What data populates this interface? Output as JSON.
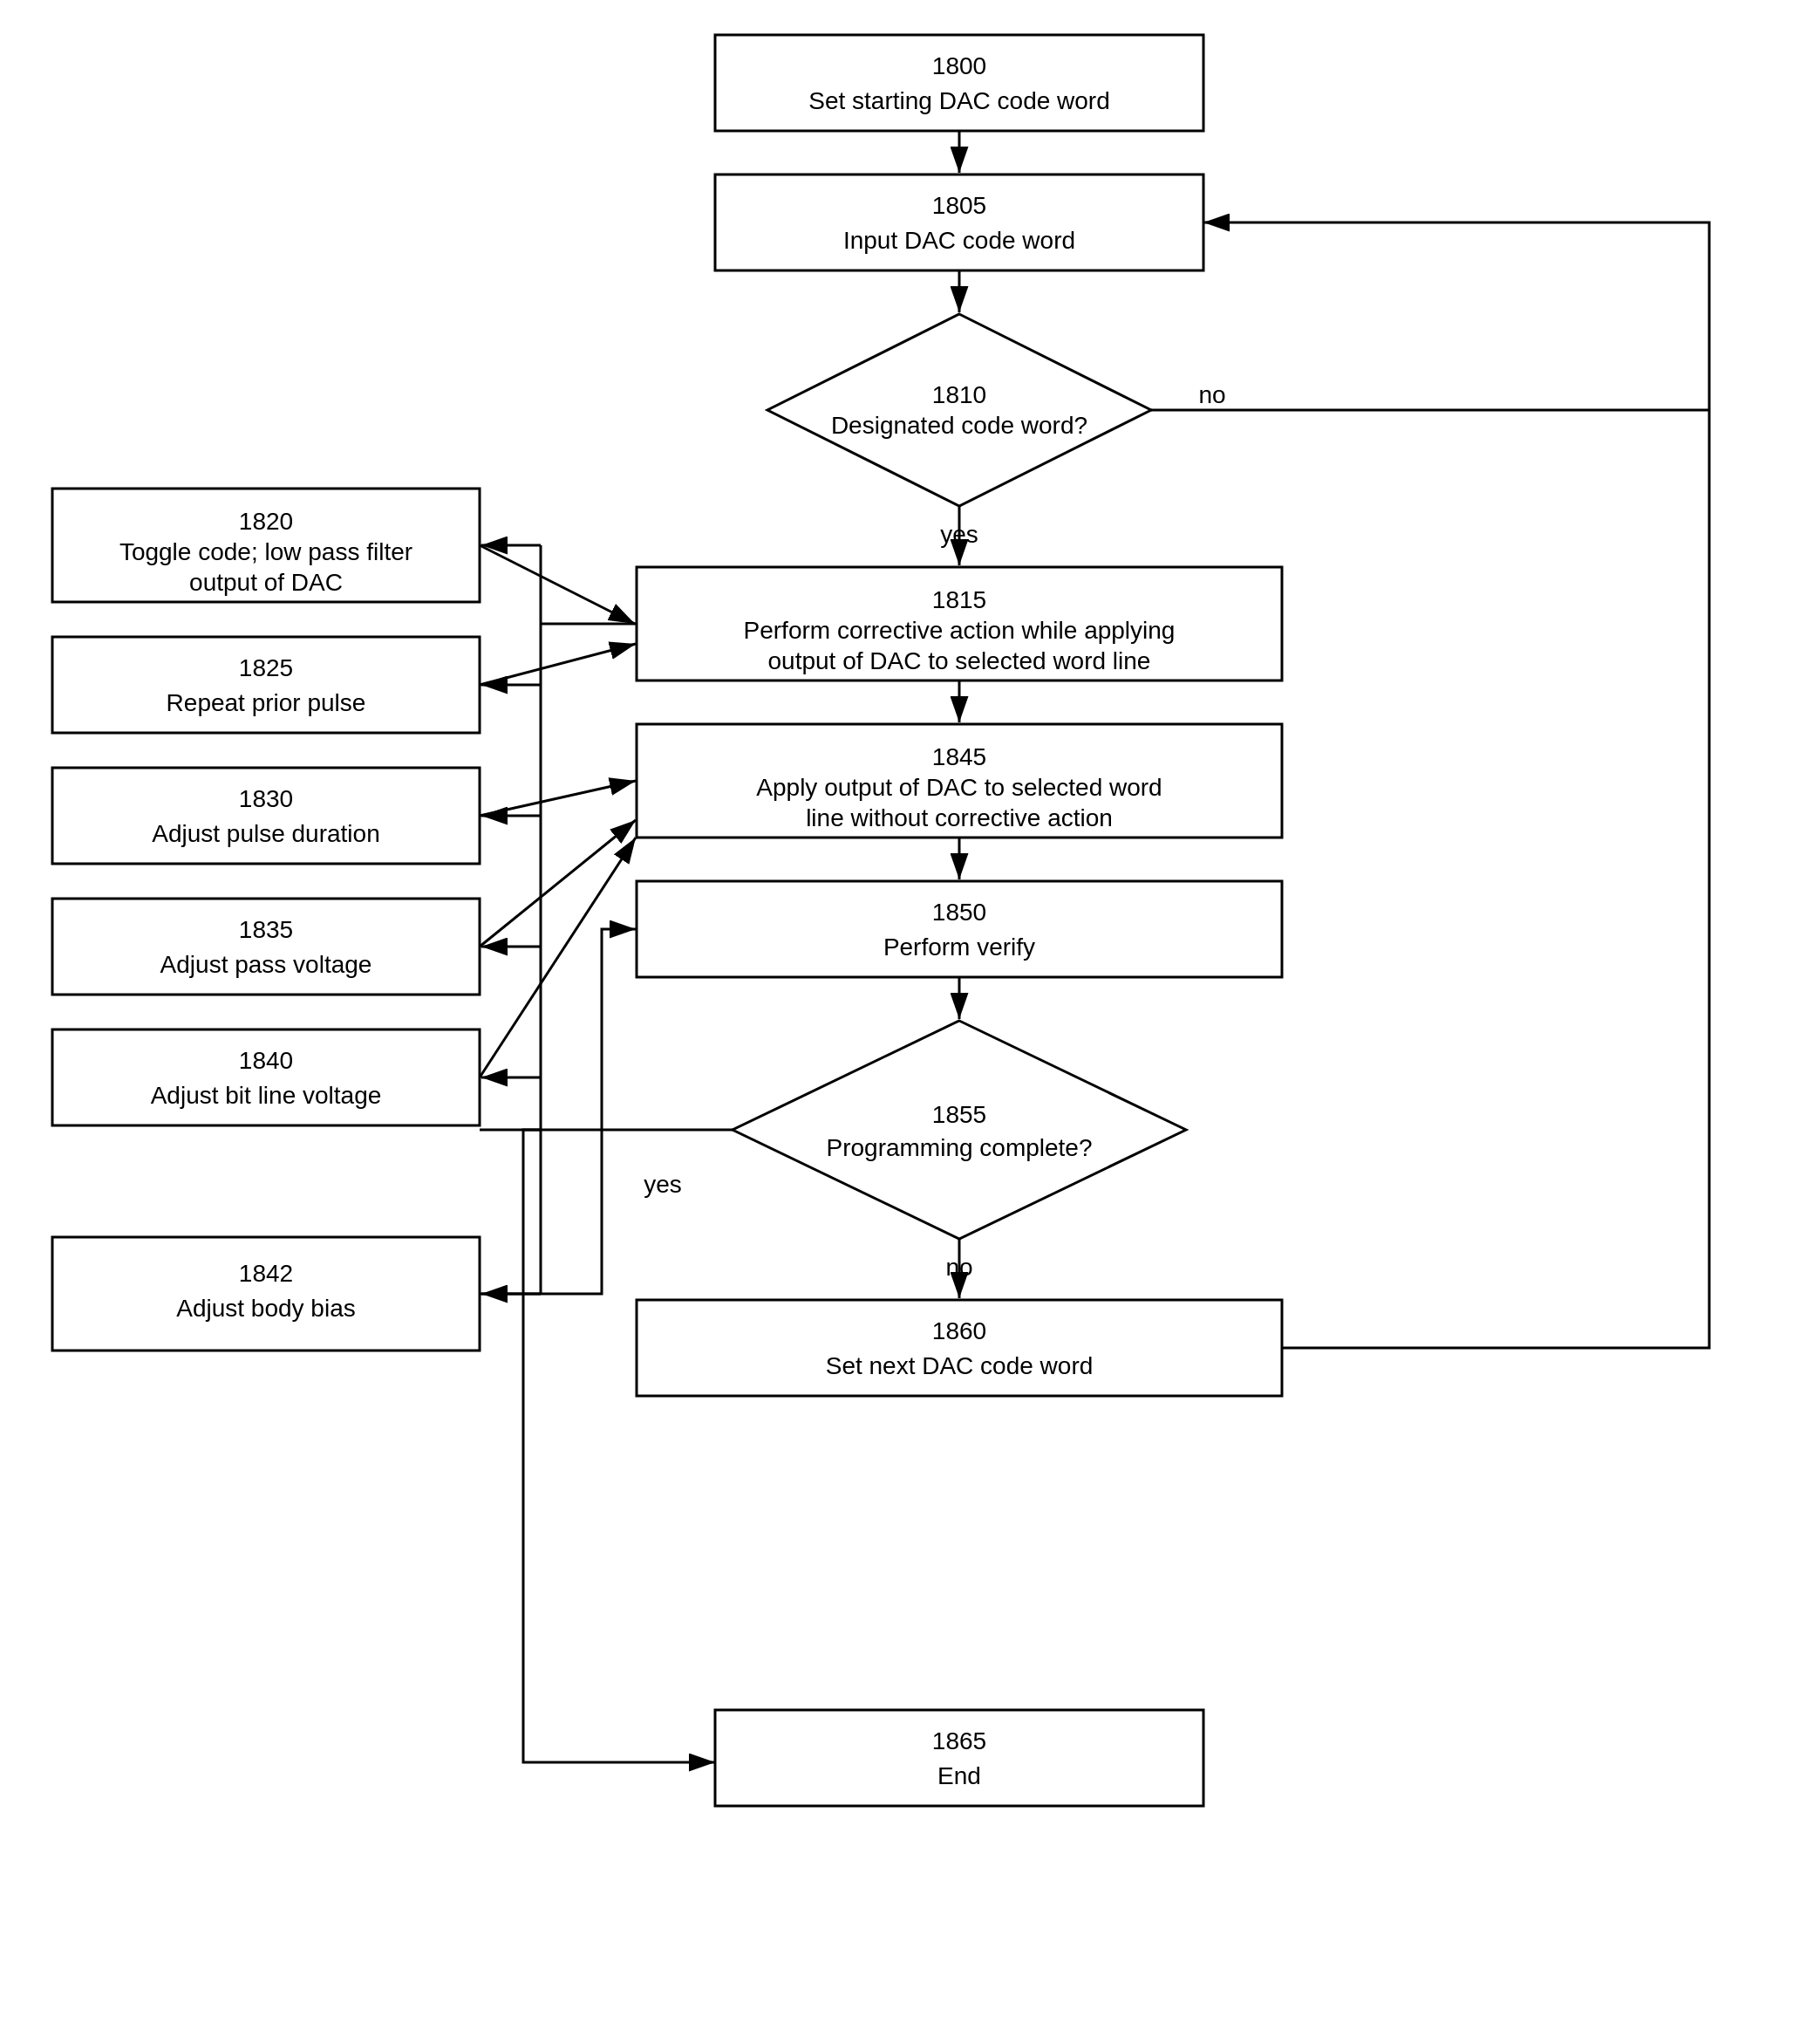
{
  "nodes": {
    "n1800": {
      "label1": "1800",
      "label2": "Set starting DAC code word"
    },
    "n1805": {
      "label1": "1805",
      "label2": "Input DAC code word"
    },
    "n1810": {
      "label1": "1810",
      "label2": "Designated code word?"
    },
    "n1815": {
      "label1": "1815",
      "label2": "Perform corrective action while applying",
      "label3": "output of DAC to selected word line"
    },
    "n1820": {
      "label1": "1820",
      "label2": "Toggle code; low pass filter",
      "label3": "output of DAC"
    },
    "n1825": {
      "label1": "1825",
      "label2": "Repeat prior pulse"
    },
    "n1830": {
      "label1": "1830",
      "label2": "Adjust pulse duration"
    },
    "n1835": {
      "label1": "1835",
      "label2": "Adjust pass voltage"
    },
    "n1840": {
      "label1": "1840",
      "label2": "Adjust bit line voltage"
    },
    "n1842": {
      "label1": "1842",
      "label2": "Adjust body bias"
    },
    "n1845": {
      "label1": "1845",
      "label2": "Apply output of DAC to selected word",
      "label3": "line without corrective action"
    },
    "n1850": {
      "label1": "1850",
      "label2": "Perform verify"
    },
    "n1855": {
      "label1": "1855",
      "label2": "Programming complete?"
    },
    "n1860": {
      "label1": "1860",
      "label2": "Set next DAC code word"
    },
    "n1865": {
      "label1": "1865",
      "label2": "End"
    }
  },
  "labels": {
    "yes": "yes",
    "no": "no"
  }
}
